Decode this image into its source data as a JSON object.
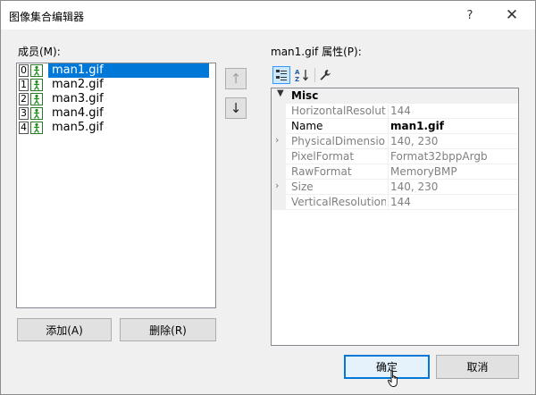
{
  "window": {
    "title": "图像集合编辑器",
    "help_label": "?",
    "close_label": "✕"
  },
  "members": {
    "label": "成员(M):",
    "items": [
      {
        "index": "0",
        "name": "man1.gif"
      },
      {
        "index": "1",
        "name": "man2.gif"
      },
      {
        "index": "2",
        "name": "man3.gif"
      },
      {
        "index": "3",
        "name": "man4.gif"
      },
      {
        "index": "4",
        "name": "man5.gif"
      }
    ],
    "selected_index": 0,
    "move_up_label": "↑",
    "move_down_label": "↓",
    "add_label": "添加(A)",
    "remove_label": "删除(R)"
  },
  "properties": {
    "label": "man1.gif 属性(P):",
    "toolbar": {
      "categorized_icon": "categorized-icon",
      "alphabetical_icon": "alphabetical-icon",
      "property_pages_icon": "wrench-icon"
    },
    "category": "Misc",
    "rows": [
      {
        "name": "HorizontalResolution",
        "value": "144",
        "expandable": false,
        "active": false
      },
      {
        "name": "Name",
        "value": "man1.gif",
        "expandable": false,
        "active": true
      },
      {
        "name": "PhysicalDimension",
        "value": "140, 230",
        "expandable": true,
        "active": false
      },
      {
        "name": "PixelFormat",
        "value": "Format32bppArgb",
        "expandable": false,
        "active": false
      },
      {
        "name": "RawFormat",
        "value": "MemoryBMP",
        "expandable": false,
        "active": false
      },
      {
        "name": "Size",
        "value": "140, 230",
        "expandable": true,
        "active": false
      },
      {
        "name": "VerticalResolution",
        "value": "144",
        "expandable": false,
        "active": false
      }
    ]
  },
  "footer": {
    "ok_label": "确定",
    "cancel_label": "取消"
  },
  "colors": {
    "selection": "#0078d7",
    "dialog_bg": "#f0f0f0"
  }
}
